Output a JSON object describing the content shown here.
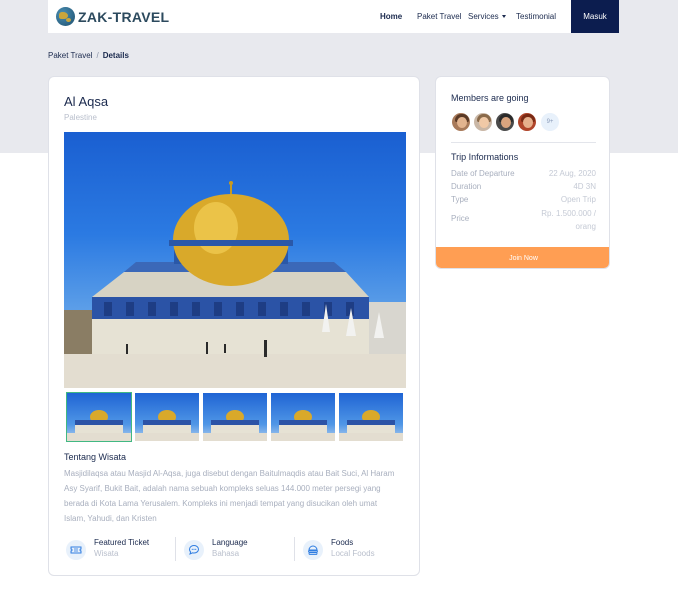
{
  "brand": {
    "name": "ZAK-TRAVEL"
  },
  "nav": {
    "items": [
      {
        "label": "Home",
        "active": true
      },
      {
        "label": "Paket Travel"
      },
      {
        "label": "Services"
      },
      {
        "label": "Testimonial"
      }
    ],
    "login_label": "Masuk"
  },
  "breadcrumb": {
    "parent": "Paket Travel",
    "separator": "/",
    "current": "Details"
  },
  "package": {
    "title": "Al Aqsa",
    "location": "Palestine",
    "gallery_count": 5,
    "about_title": "Tentang Wisata",
    "about_text": "Masjidilaqsa atau Masjid Al-Aqsa, juga disebut dengan Baitulmaqdis atau Bait Suci, Al Haram Asy Syarif, Bukit Bait, adalah nama sebuah kompleks seluas 144.000 meter persegi yang berada di Kota Lama Yerusalem. Kompleks ini menjadi tempat yang disucikan oleh umat Islam, Yahudi, dan Kristen",
    "features": [
      {
        "icon": "ticket-icon",
        "title": "Featured Ticket",
        "subtitle": "Wisata"
      },
      {
        "icon": "chat-bubble-icon",
        "title": "Language",
        "subtitle": "Bahasa"
      },
      {
        "icon": "food-icon",
        "title": "Foods",
        "subtitle": "Local Foods"
      }
    ]
  },
  "sidebar": {
    "members_title": "Members are going",
    "more_members": "9+",
    "trip_title": "Trip Informations",
    "trip_info": [
      {
        "label": "Date of Departure",
        "value": "22 Aug, 2020"
      },
      {
        "label": "Duration",
        "value": "4D 3N"
      },
      {
        "label": "Type",
        "value": "Open Trip"
      },
      {
        "label": "Price",
        "value": "Rp. 1.500.000 / orang"
      }
    ],
    "join_label": "Join Now"
  },
  "colors": {
    "primary": "#0c1d4f",
    "accent": "#ff9e53",
    "background_band": "#e8e9ee",
    "selected_thumb": "#41b883"
  }
}
